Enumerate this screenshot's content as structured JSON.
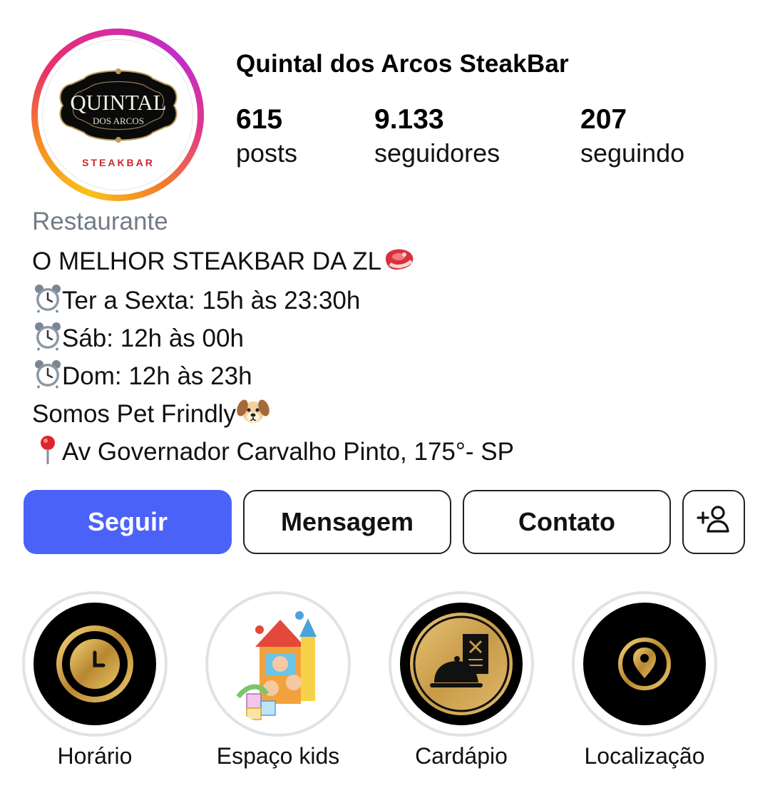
{
  "profile": {
    "name": "Quintal dos Arcos SteakBar",
    "avatar": {
      "logo_line1": "QUINTAL",
      "logo_line2": "DOS ARCOS",
      "logo_line3": "STEAKBAR"
    }
  },
  "stats": [
    {
      "value": "615",
      "label": "posts"
    },
    {
      "value": "9.133",
      "label": "seguidores"
    },
    {
      "value": "207",
      "label": "seguindo"
    }
  ],
  "bio": {
    "category": "Restaurante",
    "line1": "O MELHOR STEAKBAR DA ZL",
    "line2": "Ter a Sexta: 15h às 23:30h",
    "line3": "Sáb: 12h às 00h",
    "line4": "Dom: 12h às 23h",
    "line5": "Somos Pet Frindly",
    "line6": "Av Governador Carvalho Pinto, 175°- SP",
    "icons": [
      "meat-emoji",
      "alarm-clock-emoji",
      "dog-face-emoji",
      "round-pushpin-emoji"
    ]
  },
  "actions": {
    "follow": "Seguir",
    "message": "Mensagem",
    "contact": "Contato",
    "add_user_icon": "add-person-icon"
  },
  "highlights": [
    {
      "label": "Horário",
      "icon": "clock-icon"
    },
    {
      "label": "Espaço kids",
      "icon": "kids-playhouse-image"
    },
    {
      "label": "Cardápio",
      "icon": "menu-cloche-icon"
    },
    {
      "label": "Localização",
      "icon": "location-pin-icon"
    }
  ],
  "colors": {
    "follow_button": "#4b62f8",
    "category_text": "#737b86",
    "highlight_ring": "#dfe3e8",
    "gold": "#c9a04a"
  }
}
